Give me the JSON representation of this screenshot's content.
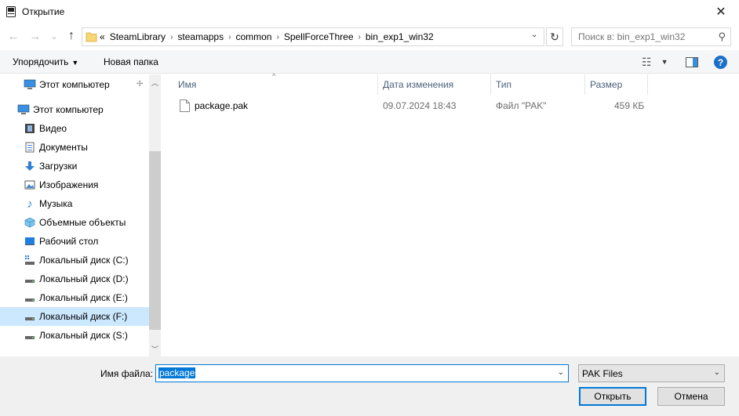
{
  "window": {
    "title": "Открытие",
    "close_glyph": "✕"
  },
  "nav": {
    "back": "←",
    "forward": "→",
    "recent": "⌄",
    "up": "↑"
  },
  "address": {
    "overflow": "«",
    "crumbs": [
      "SteamLibrary",
      "steamapps",
      "common",
      "SpellForceThree",
      "bin_exp1_win32"
    ],
    "separator": "›",
    "dropdown": "⌄",
    "refresh": "↻"
  },
  "search": {
    "placeholder": "Поиск в: bin_exp1_win32",
    "icon": "⚲"
  },
  "toolbar": {
    "organize": "Упорядочить",
    "new_folder": "Новая папка",
    "view_glyph": "☷",
    "arrow": "▼",
    "help": "?"
  },
  "sidebar": {
    "quick_item": "Этот компьютер",
    "pin": "📌",
    "root": "Этот компьютер",
    "items": [
      {
        "label": "Видео",
        "icon": "video-icon"
      },
      {
        "label": "Документы",
        "icon": "documents-icon"
      },
      {
        "label": "Загрузки",
        "icon": "downloads-icon"
      },
      {
        "label": "Изображения",
        "icon": "pictures-icon"
      },
      {
        "label": "Музыка",
        "icon": "music-icon"
      },
      {
        "label": "Объемные объекты",
        "icon": "3d-objects-icon"
      },
      {
        "label": "Рабочий стол",
        "icon": "desktop-icon"
      },
      {
        "label": "Локальный диск (C:)",
        "icon": "drive-icon"
      },
      {
        "label": "Локальный диск (D:)",
        "icon": "drive-icon"
      },
      {
        "label": "Локальный диск (E:)",
        "icon": "drive-icon"
      },
      {
        "label": "Локальный диск (F:)",
        "icon": "drive-icon",
        "selected": true
      },
      {
        "label": "Локальный диск (S:)",
        "icon": "drive-icon"
      }
    ]
  },
  "columns": {
    "name": "Имя",
    "date": "Дата изменения",
    "type": "Тип",
    "size": "Размер",
    "sort_glyph": "^"
  },
  "files": [
    {
      "name": "package.pak",
      "date": "09.07.2024 18:43",
      "type": "Файл \"PAK\"",
      "size": "459 КБ"
    }
  ],
  "footer": {
    "filename_label": "Имя файла:",
    "filename_value": "package",
    "filter_value": "PAK Files",
    "open": "Открыть",
    "cancel": "Отмена",
    "dropdown": "⌄"
  },
  "colors": {
    "accent": "#0078d7",
    "selection": "#cce8ff",
    "header_text": "#4c607a"
  }
}
